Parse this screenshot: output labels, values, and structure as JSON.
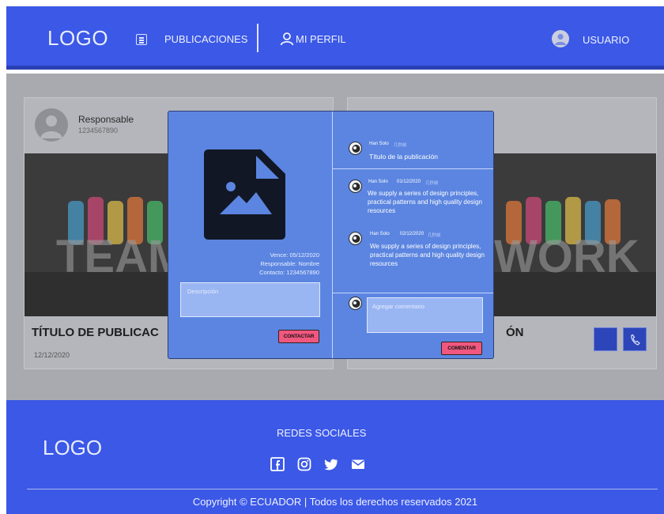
{
  "header": {
    "logo": "LOGO",
    "nav_publicaciones": "PUBLICACIONES",
    "nav_perfil": "MI PERFIL",
    "user_label": "USUARIO"
  },
  "cards": [
    {
      "responsable": "Responsable",
      "phone": "1234567890",
      "title": "TÍTULO DE PUBLICAC",
      "date": "12/12/2020",
      "image_word": "TEAM"
    },
    {
      "title": "ÓN",
      "image_word": "WORK"
    }
  ],
  "modal": {
    "vence": "Vence: 05/12/2020",
    "responsable": "Responsable: Nombre",
    "contacto": "Contacto: 1234567890",
    "description_placeholder": "Descripción",
    "contact_button": "CONTACTAR",
    "publication": {
      "author": "Han Solo",
      "tag": "几秒前",
      "title": "Título de la publicación"
    },
    "comments": [
      {
        "author": "Han Solo",
        "date": "01/12/2020",
        "tag": "几秒前",
        "text": "We supply a series of design principles, practical patterns and high quality design resources"
      },
      {
        "author": "Han Solo",
        "date": "02/12/2020",
        "tag": "几秒前",
        "text": "We supply a series of design principles, practical patterns and high quality design resources"
      }
    ],
    "comment_placeholder": "Agregar comentario",
    "comment_button": "COMENTAR"
  },
  "footer": {
    "logo": "LOGO",
    "social_title": "REDES SOCIALES",
    "social_icons": [
      "facebook-icon",
      "instagram-icon",
      "twitter-icon",
      "mail-icon"
    ],
    "copyright": "Copyright © ECUADOR | Todos los derechos reservados 2021"
  },
  "colors": {
    "primary": "#3b58e6",
    "modal": "#5b85e0",
    "button_pink": "#f1577f"
  }
}
